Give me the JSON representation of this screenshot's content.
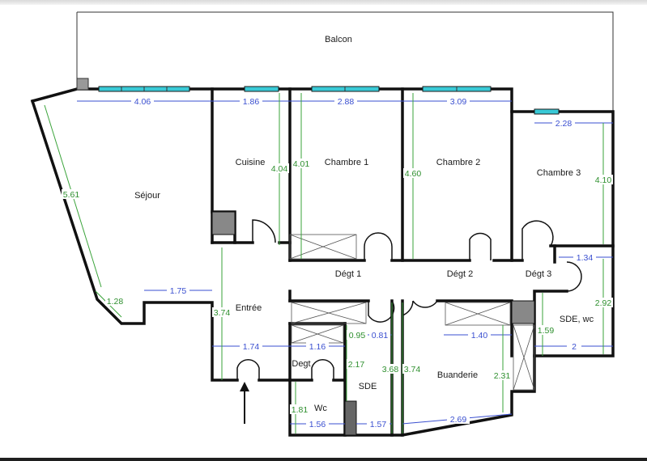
{
  "rooms": {
    "balcon": "Balcon",
    "sejour": "Séjour",
    "cuisine": "Cuisine",
    "chambre1": "Chambre 1",
    "chambre2": "Chambre 2",
    "chambre3": "Chambre 3",
    "entree": "Entrée",
    "degt1": "Dégt 1",
    "degt2": "Dégt 2",
    "degt3": "Dégt 3",
    "degt": "Degt",
    "sde_wc": "SDE, wc",
    "sde": "SDE",
    "wc": "Wc",
    "buanderie": "Buanderie"
  },
  "dimensions": {
    "sejour_width": "4.06",
    "cuisine_width": "1.86",
    "chambre1_width": "2.88",
    "chambre2_width": "3.09",
    "chambre3_width": "2.28",
    "sejour_diag": "5.61",
    "cuisine_depth": "4.04",
    "chambre1_depth": "4.01",
    "chambre2_depth": "4.60",
    "chambre3_depth": "4.10",
    "sejour_short": "1.28",
    "sejour_bottom": "1.75",
    "entree_depth": "3.74",
    "degt3_width": "1.34",
    "sdewc_depth": "2.92",
    "sdewc_inner": "1.59",
    "sdewc_width": "2",
    "sde_width_a": "0.95",
    "sde_width_b": "0.81",
    "buanderie_top": "1.40",
    "entree_width": "1.74",
    "degt_width": "1.16",
    "sde_depth": "2.17",
    "sde_height": "3.68",
    "buanderie_depth": "3.74",
    "buanderie_inner": "2.31",
    "wc_depth": "1.81",
    "wc_width": "1.56",
    "sde_bottom": "1.57",
    "buanderie_bottom": "2.69"
  },
  "colors": {
    "wall": "#111111",
    "dim_blue": "#3a4fd0",
    "dim_green": "#2e8f2e",
    "window": "#39c9d6"
  }
}
